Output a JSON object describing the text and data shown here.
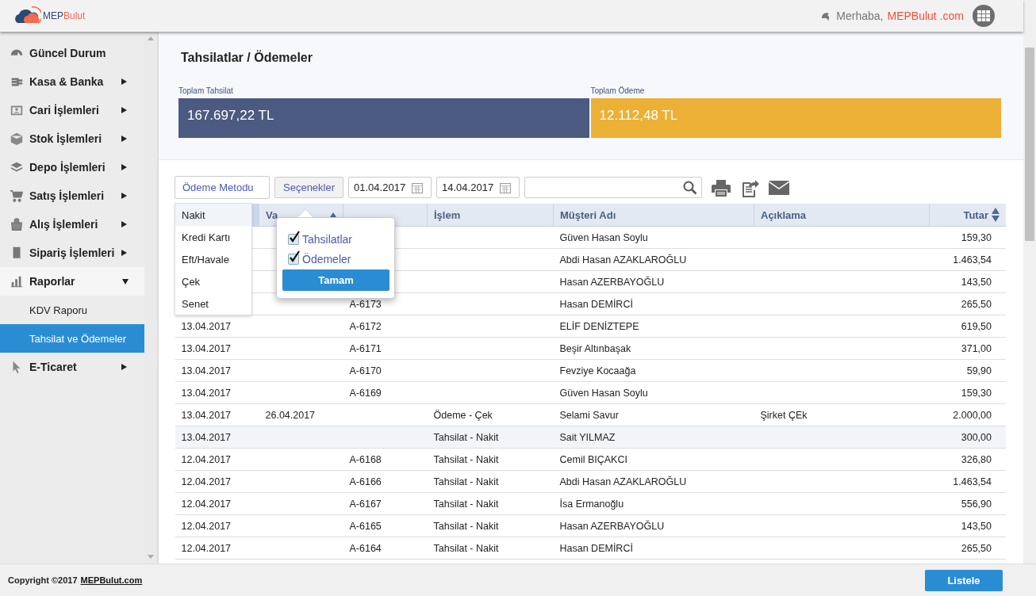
{
  "header": {
    "logo": {
      "part_1": "MEP",
      "part_2": "Bulut"
    },
    "greeting": "Merhaba,",
    "user": "MEPBulut .com"
  },
  "sidebar": {
    "items": [
      {
        "label": "Güncel Durum"
      },
      {
        "label": "Kasa & Banka",
        "expanded": false
      },
      {
        "label": "Cari İşlemleri",
        "expanded": false
      },
      {
        "label": "Stok İşlemleri",
        "expanded": false
      },
      {
        "label": "Depo İşlemleri",
        "expanded": false
      },
      {
        "label": "Satış İşlemleri",
        "expanded": false
      },
      {
        "label": "Alış İşlemleri",
        "expanded": false
      },
      {
        "label": "Sipariş İşlemleri",
        "expanded": false
      },
      {
        "label": "Raporlar",
        "expanded": true,
        "children": [
          {
            "label": "KDV Raporu",
            "selected": false
          },
          {
            "label": "Tahsilat ve Ödemeler",
            "selected": true
          }
        ]
      },
      {
        "label": "E-Ticaret",
        "expanded": false
      }
    ]
  },
  "page_title": "Tahsilatlar / Ödemeler",
  "totals": [
    {
      "label": "Toplam Tahsilat",
      "value": "167.697,22 TL",
      "color": "#4a5a80"
    },
    {
      "label": "Toplam Ödeme",
      "value": "12.112,48 TL",
      "color": "#ebb035"
    }
  ],
  "toolbar": {
    "method_dropdown": "Ödeme Metodu",
    "options_button": "Seçenekler",
    "date_from": "01.04.2017",
    "date_to": "14.04.2017"
  },
  "method_menu": [
    {
      "label": "Nakit",
      "selected": true
    },
    {
      "label": "Kredi Kartı",
      "selected": false
    },
    {
      "label": "Eft/Havale",
      "selected": false
    },
    {
      "label": "Çek",
      "selected": false
    },
    {
      "label": "Senet",
      "selected": false
    }
  ],
  "options_popup": {
    "checkboxes": [
      {
        "label": "Tahsilatlar",
        "checked": true
      },
      {
        "label": "Ödemeler",
        "checked": true
      }
    ],
    "button": "Tamam"
  },
  "table": {
    "columns": [
      {
        "kind": "sorted"
      },
      {
        "label": "Va",
        "kind": "sort_up"
      },
      {
        "kind": "plain"
      },
      {
        "label": "İşlem",
        "kind": "plain"
      },
      {
        "label": "Müşteri Adı",
        "kind": "plain"
      },
      {
        "label": "Açıklama",
        "kind": "plain"
      },
      {
        "label": "Tutar",
        "kind": "sortable"
      }
    ],
    "rows": [
      {
        "customer": "Güven Hasan Soylu",
        "amount": "159,30",
        "selected": false
      },
      {
        "customer": "Abdi Hasan AZAKLAROĞLU",
        "amount": "1.463,54",
        "selected": false
      },
      {
        "customer": "Hasan AZERBAYOĞLU",
        "amount": "143,50",
        "selected": false
      },
      {
        "doc": "A-6173",
        "customer": "Hasan DEMİRCİ",
        "amount": "265,50",
        "selected": false
      },
      {
        "date": "13.04.2017",
        "doc": "A-6172",
        "customer": "ELİF DENİZTEPE",
        "amount": "619,50",
        "selected": false
      },
      {
        "date": "13.04.2017",
        "doc": "A-6171",
        "customer": "Beşir Altınbaşak",
        "amount": "371,00",
        "selected": false
      },
      {
        "date": "13.04.2017",
        "doc": "A-6170",
        "customer": "Fevziye Kocaağa",
        "amount": "59,90",
        "selected": false
      },
      {
        "date": "13.04.2017",
        "doc": "A-6169",
        "customer": "Güven Hasan Soylu",
        "amount": "159,30",
        "selected": false
      },
      {
        "date": "13.04.2017",
        "due": "26.04.2017",
        "type": "Ödeme - Çek",
        "customer": "Selami Savur",
        "note": "Şirket ÇEk",
        "amount": "2.000,00",
        "selected": false
      },
      {
        "date": "13.04.2017",
        "type": "Tahsilat - Nakit",
        "customer": "Sait YILMAZ",
        "amount": "300,00",
        "selected": true
      },
      {
        "date": "12.04.2017",
        "doc": "A-6168",
        "type": "Tahsilat - Nakit",
        "customer": "Cemil BIÇAKCI",
        "amount": "326,80",
        "selected": false
      },
      {
        "date": "12.04.2017",
        "doc": "A-6166",
        "type": "Tahsilat - Nakit",
        "customer": "Abdi Hasan AZAKLAROĞLU",
        "amount": "1.463,54",
        "selected": false
      },
      {
        "date": "12.04.2017",
        "doc": "A-6167",
        "type": "Tahsilat - Nakit",
        "customer": "İsa Ermanoğlu",
        "amount": "556,90",
        "selected": false
      },
      {
        "date": "12.04.2017",
        "doc": "A-6165",
        "type": "Tahsilat - Nakit",
        "customer": "Hasan AZERBAYOĞLU",
        "amount": "143,50",
        "selected": false
      },
      {
        "date": "12.04.2017",
        "doc": "A-6164",
        "type": "Tahsilat - Nakit",
        "customer": "Hasan DEMİRCİ",
        "amount": "265,50",
        "selected": false
      }
    ]
  },
  "footer": {
    "copyright": "Copyright ©2017",
    "link": "MEPBulut.com",
    "button": "Listele"
  }
}
